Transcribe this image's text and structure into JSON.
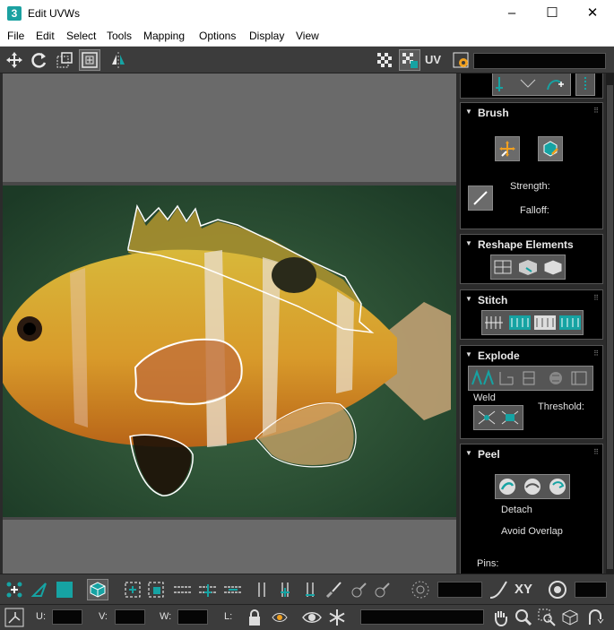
{
  "window": {
    "app_icon": "3",
    "title": "Edit UVWs",
    "minimize": "–",
    "maximize": "☐",
    "close": "✕"
  },
  "menu": [
    "File",
    "Edit",
    "Select",
    "Tools",
    "Mapping",
    "Options",
    "Display",
    "View"
  ],
  "toolbar": {
    "uv_label": "UV"
  },
  "panel": {
    "brush": {
      "title": "Brush",
      "strength_label": "Strength:",
      "falloff_label": "Falloff:"
    },
    "reshape": {
      "title": "Reshape Elements"
    },
    "stitch": {
      "title": "Stitch"
    },
    "explode": {
      "title": "Explode",
      "weld_label": "Weld",
      "threshold_label": "Threshold:"
    },
    "peel": {
      "title": "Peel",
      "detach_label": "Detach",
      "avoid_overlap_label": "Avoid Overlap",
      "pins_label": "Pins:"
    }
  },
  "bottom": {
    "xy_label": "XY",
    "u_label": "U:",
    "v_label": "V:",
    "w_label": "W:",
    "l_label": "L:"
  },
  "colors": {
    "teal_accent": "#16a3a3",
    "uv_outline": "#ffffff",
    "toolbar_bg": "#3c3c3c",
    "panel_bg": "#000000"
  }
}
